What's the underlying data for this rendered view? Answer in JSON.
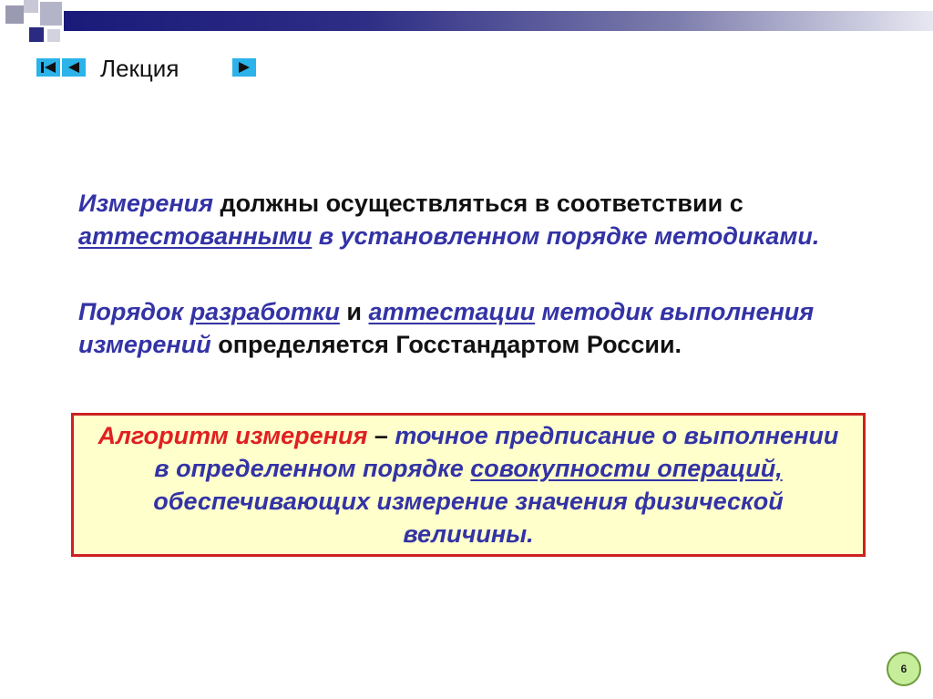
{
  "nav": {
    "label": "Лекция",
    "first_icon": "skip-to-first-icon",
    "prev_icon": "previous-icon",
    "next_icon": "next-icon"
  },
  "paragraph1": {
    "term": "Измерения",
    "text1": " должны осуществляться в соответствии с ",
    "link": "аттестованными",
    "text2": " в установленном порядке методиками."
  },
  "paragraph2": {
    "text1": "Порядок ",
    "link1": "разработки",
    "text2": " и ",
    "link2": "аттестации",
    "text3": " методик выполнения измерений",
    "text4": " определяется Госстандартом России."
  },
  "definition": {
    "term": "Алгоритм измерения",
    "dash": " – ",
    "text1": "точное предписание о выполнении в определенном порядке ",
    "link": "совокупности операций,",
    "text2": " обеспечивающих измерение значения физической величины."
  },
  "page_number": "6",
  "colors": {
    "accent_blue": "#3333a6",
    "term_red": "#e02020",
    "box_background": "#ffffcc",
    "box_border": "#cc2222",
    "nav_button": "#2bb3ea"
  }
}
